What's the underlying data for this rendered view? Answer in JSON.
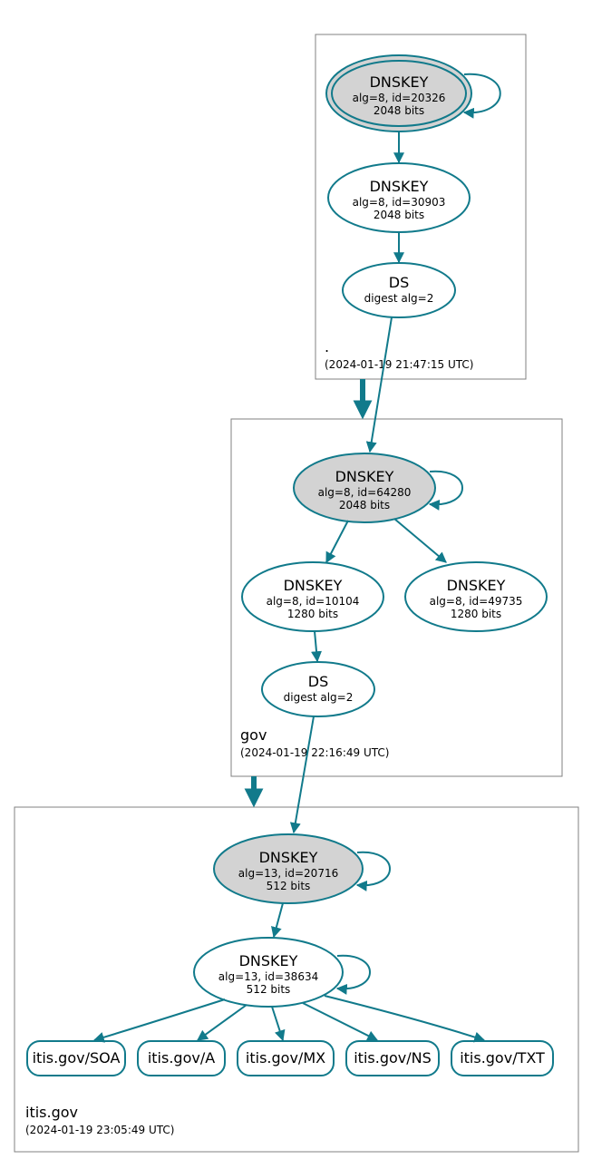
{
  "zones": {
    "root": {
      "label": ".",
      "timestamp": "(2024-01-19 21:47:15 UTC)"
    },
    "gov": {
      "label": "gov",
      "timestamp": "(2024-01-19 22:16:49 UTC)"
    },
    "itis": {
      "label": "itis.gov",
      "timestamp": "(2024-01-19 23:05:49 UTC)"
    }
  },
  "nodes": {
    "root_ksk": {
      "title": "DNSKEY",
      "line2": "alg=8, id=20326",
      "line3": "2048 bits"
    },
    "root_zsk": {
      "title": "DNSKEY",
      "line2": "alg=8, id=30903",
      "line3": "2048 bits"
    },
    "root_ds": {
      "title": "DS",
      "line2": "digest alg=2"
    },
    "gov_ksk": {
      "title": "DNSKEY",
      "line2": "alg=8, id=64280",
      "line3": "2048 bits"
    },
    "gov_zsk1": {
      "title": "DNSKEY",
      "line2": "alg=8, id=10104",
      "line3": "1280 bits"
    },
    "gov_zsk2": {
      "title": "DNSKEY",
      "line2": "alg=8, id=49735",
      "line3": "1280 bits"
    },
    "gov_ds": {
      "title": "DS",
      "line2": "digest alg=2"
    },
    "itis_ksk": {
      "title": "DNSKEY",
      "line2": "alg=13, id=20716",
      "line3": "512 bits"
    },
    "itis_zsk": {
      "title": "DNSKEY",
      "line2": "alg=13, id=38634",
      "line3": "512 bits"
    },
    "rr_soa": {
      "title": "itis.gov/SOA"
    },
    "rr_a": {
      "title": "itis.gov/A"
    },
    "rr_mx": {
      "title": "itis.gov/MX"
    },
    "rr_ns": {
      "title": "itis.gov/NS"
    },
    "rr_txt": {
      "title": "itis.gov/TXT"
    }
  },
  "colors": {
    "stroke": "#117a8b",
    "shaded": "#d3d3d3",
    "box": "#808080"
  }
}
